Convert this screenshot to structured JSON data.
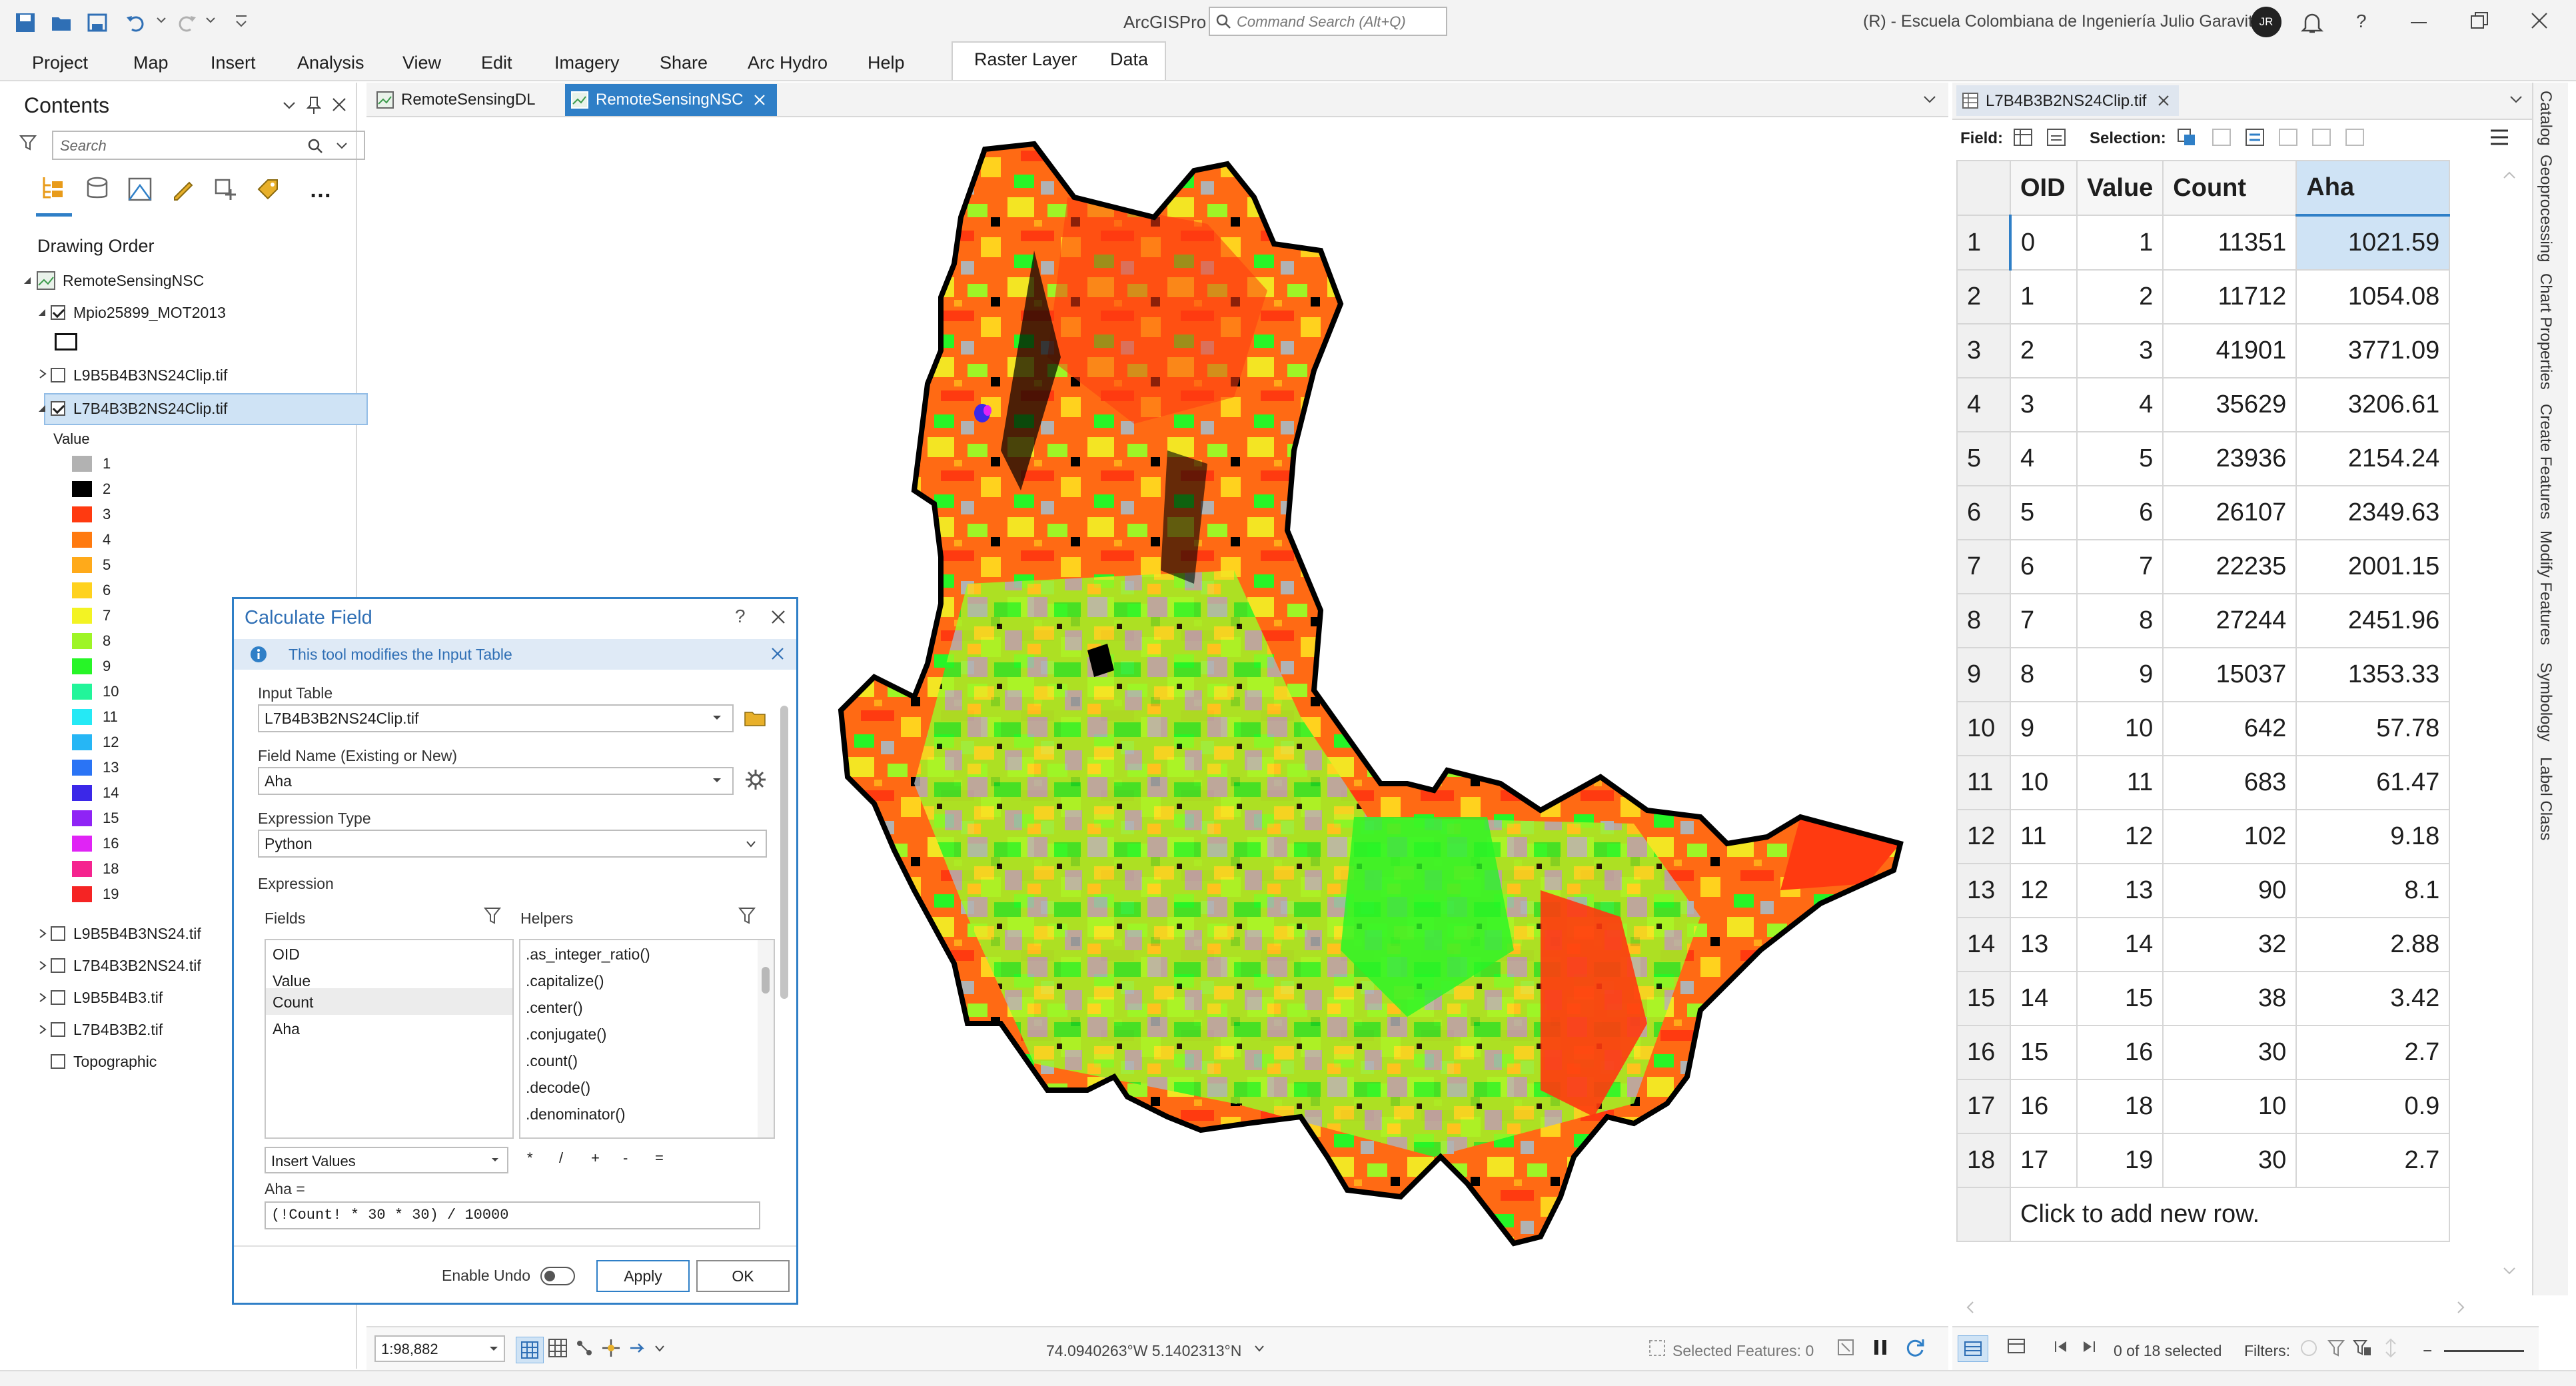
{
  "titlebar": {
    "app_title": "ArcGISPro",
    "search_placeholder": "Command Search (Alt+Q)",
    "account": "(R) - Escuela Colombiana de Ingeniería Julio Garavito",
    "avatar_initials": "JR",
    "help": "?"
  },
  "menu": [
    "Project",
    "Map",
    "Insert",
    "Analysis",
    "View",
    "Edit",
    "Imagery",
    "Share",
    "Arc Hydro",
    "Help"
  ],
  "context_tabs": [
    "Raster Layer",
    "Data"
  ],
  "contents": {
    "title": "Contents",
    "search_placeholder": "Search",
    "drawing_order": "Drawing Order",
    "map_name": "RemoteSensingNSC",
    "layers_top": [
      {
        "name": "Mpio25899_MOT2013",
        "checked": true
      },
      {
        "name": "L9B5B4B3NS24Clip.tif",
        "checked": false
      },
      {
        "name": "L7B4B3B2NS24Clip.tif",
        "checked": true
      }
    ],
    "legend_title": "Value",
    "legend": [
      {
        "label": "1",
        "color": "#b2b2b2"
      },
      {
        "label": "2",
        "color": "#000000"
      },
      {
        "label": "3",
        "color": "#ff3a10"
      },
      {
        "label": "4",
        "color": "#ff7a10"
      },
      {
        "label": "5",
        "color": "#ffaa1a"
      },
      {
        "label": "6",
        "color": "#ffd21e"
      },
      {
        "label": "7",
        "color": "#f3f323"
      },
      {
        "label": "8",
        "color": "#9ef526"
      },
      {
        "label": "9",
        "color": "#27f527"
      },
      {
        "label": "10",
        "color": "#22f59a"
      },
      {
        "label": "11",
        "color": "#25e9f5"
      },
      {
        "label": "12",
        "color": "#26b6f5"
      },
      {
        "label": "13",
        "color": "#2a74f5"
      },
      {
        "label": "14",
        "color": "#3b28e8"
      },
      {
        "label": "15",
        "color": "#8f24f5"
      },
      {
        "label": "16",
        "color": "#e024f5"
      },
      {
        "label": "18",
        "color": "#f5248f"
      },
      {
        "label": "19",
        "color": "#f52424"
      }
    ],
    "layers_bottom": [
      {
        "name": "L9B5B4B3NS24.tif"
      },
      {
        "name": "L7B4B3B2NS24.tif"
      },
      {
        "name": "L9B5B4B3.tif"
      },
      {
        "name": "L7B4B3B2.tif"
      },
      {
        "name": "Topographic"
      }
    ]
  },
  "map_tabs": [
    "RemoteSensingDL",
    "RemoteSensingNSC"
  ],
  "dialog": {
    "title": "Calculate Field",
    "help": "?",
    "info": "This tool modifies the Input Table",
    "input_table_label": "Input Table",
    "input_table_value": "L7B4B3B2NS24Clip.tif",
    "field_name_label": "Field Name (Existing or New)",
    "field_name_value": "Aha",
    "expr_type_label": "Expression Type",
    "expr_type_value": "Python",
    "expression_label": "Expression",
    "fields_label": "Fields",
    "helpers_label": "Helpers",
    "fields": [
      "OID",
      "Value",
      "Count",
      "Aha"
    ],
    "helpers": [
      ".as_integer_ratio()",
      ".capitalize()",
      ".center()",
      ".conjugate()",
      ".count()",
      ".decode()",
      ".denominator()"
    ],
    "insert_values": "Insert Values",
    "operators": [
      "*",
      "/",
      "+",
      "-",
      "="
    ],
    "expr_target": "Aha =",
    "expression": "(!Count! * 30 * 30) / 10000",
    "enable_undo": "Enable Undo",
    "apply": "Apply",
    "ok": "OK"
  },
  "status_bar": {
    "scale": "1:98,882",
    "coords": "74.0940263°W 5.1402313°N",
    "selected_features": "Selected Features: 0"
  },
  "table": {
    "tab_title": "L7B4B3B2NS24Clip.tif",
    "field_label": "Field:",
    "selection_label": "Selection:",
    "columns": [
      "OID",
      "Value",
      "Count",
      "Aha"
    ],
    "rows": [
      [
        "1",
        "0",
        "1",
        "11351",
        "1021.59"
      ],
      [
        "2",
        "1",
        "2",
        "11712",
        "1054.08"
      ],
      [
        "3",
        "2",
        "3",
        "41901",
        "3771.09"
      ],
      [
        "4",
        "3",
        "4",
        "35629",
        "3206.61"
      ],
      [
        "5",
        "4",
        "5",
        "23936",
        "2154.24"
      ],
      [
        "6",
        "5",
        "6",
        "26107",
        "2349.63"
      ],
      [
        "7",
        "6",
        "7",
        "22235",
        "2001.15"
      ],
      [
        "8",
        "7",
        "8",
        "27244",
        "2451.96"
      ],
      [
        "9",
        "8",
        "9",
        "15037",
        "1353.33"
      ],
      [
        "10",
        "9",
        "10",
        "642",
        "57.78"
      ],
      [
        "11",
        "10",
        "11",
        "683",
        "61.47"
      ],
      [
        "12",
        "11",
        "12",
        "102",
        "9.18"
      ],
      [
        "13",
        "12",
        "13",
        "90",
        "8.1"
      ],
      [
        "14",
        "13",
        "14",
        "32",
        "2.88"
      ],
      [
        "15",
        "14",
        "15",
        "38",
        "3.42"
      ],
      [
        "16",
        "15",
        "16",
        "30",
        "2.7"
      ],
      [
        "17",
        "16",
        "18",
        "10",
        "0.9"
      ],
      [
        "18",
        "17",
        "19",
        "30",
        "2.7"
      ]
    ],
    "add_row": "Click to add new row.",
    "selected": "0 of 18 selected",
    "filters": "Filters:"
  },
  "dock_tabs": [
    "Catalog",
    "Geoprocessing",
    "Chart Properties",
    "Create Features",
    "Modify Features",
    "Symbology",
    "Label Class"
  ]
}
